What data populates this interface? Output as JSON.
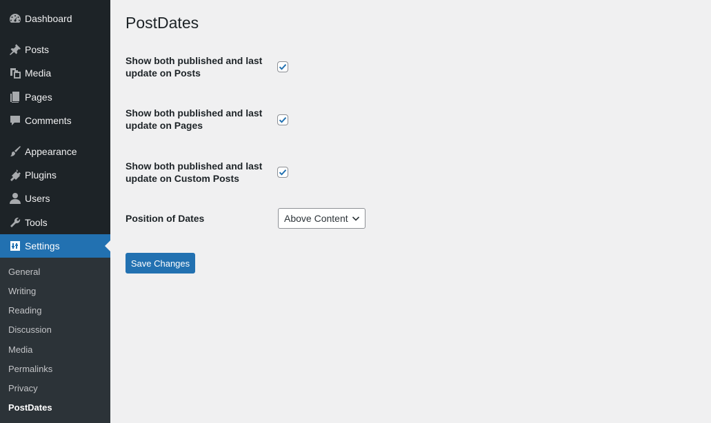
{
  "sidebar": {
    "items": [
      {
        "label": "Dashboard",
        "icon": "dashboard-icon"
      },
      {
        "label": "Posts",
        "icon": "pin-icon"
      },
      {
        "label": "Media",
        "icon": "media-icon"
      },
      {
        "label": "Pages",
        "icon": "pages-icon"
      },
      {
        "label": "Comments",
        "icon": "comments-icon"
      },
      {
        "label": "Appearance",
        "icon": "paintbrush-icon"
      },
      {
        "label": "Plugins",
        "icon": "plugins-icon"
      },
      {
        "label": "Users",
        "icon": "users-icon"
      },
      {
        "label": "Tools",
        "icon": "wrench-icon"
      },
      {
        "label": "Settings",
        "icon": "settings-icon",
        "active": true
      }
    ],
    "submenu": [
      "General",
      "Writing",
      "Reading",
      "Discussion",
      "Media",
      "Permalinks",
      "Privacy",
      "PostDates"
    ],
    "submenu_current": "PostDates"
  },
  "main": {
    "title": "PostDates",
    "fields": [
      {
        "label": "Show both published and last update on Posts",
        "checked": true
      },
      {
        "label": "Show both published and last update on Pages",
        "checked": true
      },
      {
        "label": "Show both published and last update on Custom Posts",
        "checked": true
      }
    ],
    "position": {
      "label": "Position of Dates",
      "selected": "Above Content"
    },
    "save_label": "Save Changes"
  },
  "colors": {
    "sidebar_bg": "#1d2327",
    "submenu_bg": "#2c3338",
    "accent": "#2271b1",
    "page_bg": "#f0f0f1"
  }
}
